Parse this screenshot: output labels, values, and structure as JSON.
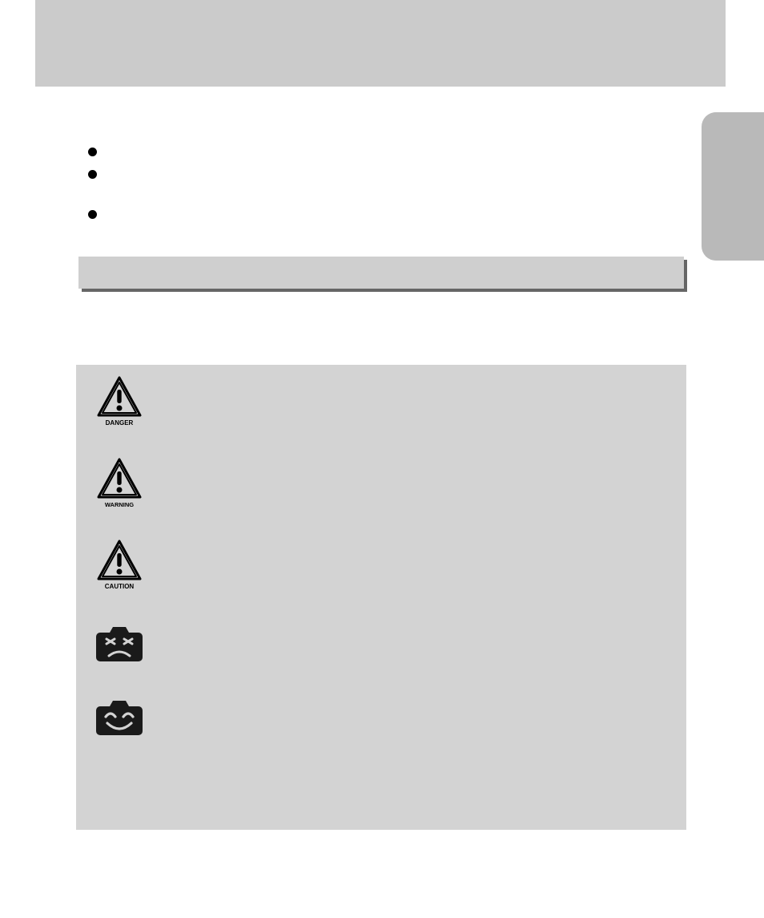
{
  "bullets": {
    "b1": "",
    "b2": "",
    "b3": ""
  },
  "section": {
    "title": ""
  },
  "intro": "",
  "rows": {
    "danger": {
      "label": "DANGER",
      "body": ""
    },
    "warning": {
      "label": "WARNING",
      "body": ""
    },
    "caution": {
      "label": "CAUTION",
      "body": ""
    },
    "sad": {
      "label": "",
      "body": ""
    },
    "happy": {
      "label": "",
      "body": ""
    }
  }
}
